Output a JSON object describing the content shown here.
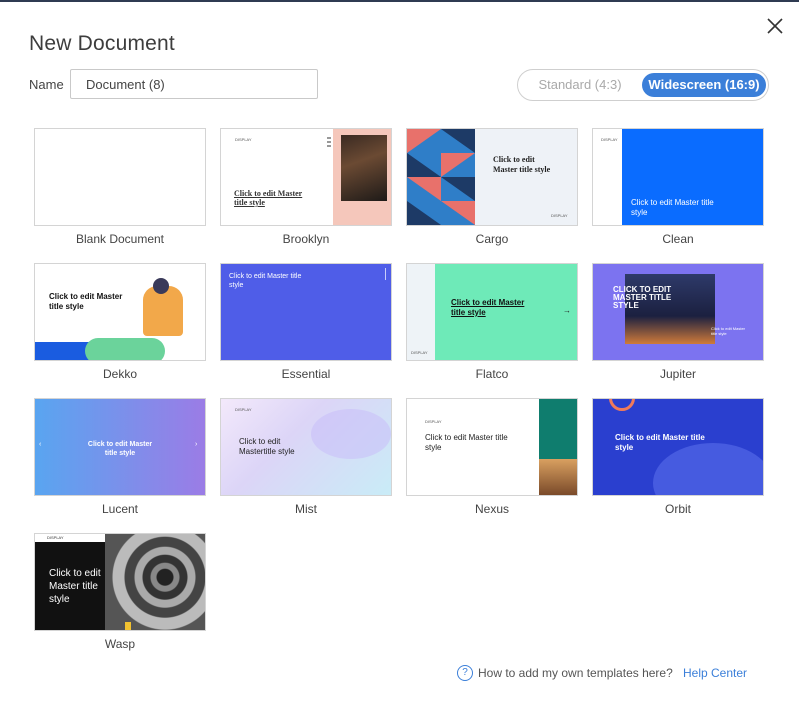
{
  "dialog": {
    "title": "New Document",
    "name_label": "Name",
    "name_value": "Document (8)",
    "close_icon": "close-icon"
  },
  "aspect": {
    "standard_label": "Standard (4:3)",
    "widescreen_label": "Widescreen (16:9)",
    "selected": "widescreen"
  },
  "templates": [
    {
      "name": "Blank Document"
    },
    {
      "name": "Brooklyn",
      "title": "Click to edit Master title style",
      "brand": "DISPLAY"
    },
    {
      "name": "Cargo",
      "title": "Click to edit Master title style",
      "brand": "DISPLAY"
    },
    {
      "name": "Clean",
      "title": "Click to edit Master title style",
      "brand": "DISPLAY"
    },
    {
      "name": "Dekko",
      "title": "Click to edit Master title style"
    },
    {
      "name": "Essential",
      "title": "Click to edit Master title style"
    },
    {
      "name": "Flatco",
      "title": "Click to edit Master title style",
      "brand": "DISPLAY"
    },
    {
      "name": "Jupiter",
      "title": "CLICK TO EDIT MASTER TITLE STYLE",
      "body": "Click to edit Master title style"
    },
    {
      "name": "Lucent",
      "title": "Click to edit Master title style"
    },
    {
      "name": "Mist",
      "title": "Click to edit Mastertitle style",
      "brand": "DISPLAY"
    },
    {
      "name": "Nexus",
      "title": "Click to edit Master title style",
      "brand": "DISPLAY"
    },
    {
      "name": "Orbit",
      "title": "Click to edit Master title style"
    },
    {
      "name": "Wasp",
      "title": "Click to edit Master title style",
      "brand": "DISPLAY"
    }
  ],
  "help": {
    "question": "How to add my own templates here?",
    "link": "Help Center",
    "icon": "?"
  },
  "colors": {
    "accent": "#3b7fd9",
    "clean_blue": "#0a6cff",
    "essential_purple": "#4f5de8",
    "flatco_green": "#6eeab8",
    "jupiter_violet": "#7c73f0",
    "orbit_blue": "#2a3fcf",
    "nexus_teal": "#0f7d6e"
  }
}
